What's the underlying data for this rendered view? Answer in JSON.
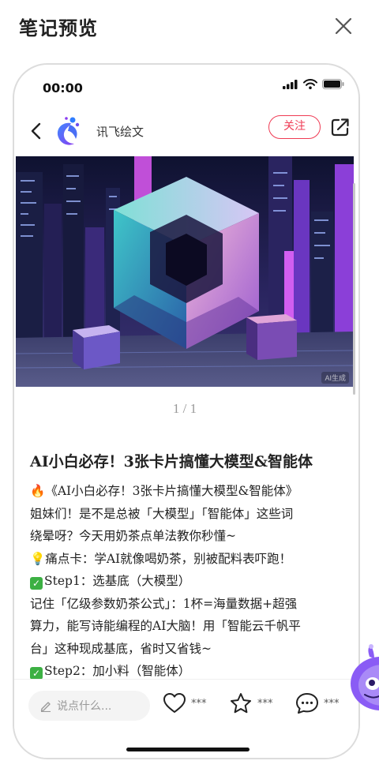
{
  "header": {
    "title": "笔记预览"
  },
  "status_bar": {
    "time": "00:00"
  },
  "author": {
    "name": "讯飞绘文",
    "follow_label": "关注"
  },
  "image": {
    "ai_tag": "AI生成"
  },
  "pager": {
    "text": "1 / 1"
  },
  "note": {
    "title": "AI小白必存！3张卡片搞懂大模型&智能体",
    "lines": [
      "《AI小白必存！3张卡片搞懂大模型&智能体》",
      "姐妹们！是不是总被「大模型」「智能体」这些词",
      "绕晕呀？今天用奶茶点单法教你秒懂~",
      "痛点卡：学AI就像喝奶茶，别被配料表吓跑！",
      "Step1：选基底（大模型）",
      "记住「亿级参数奶茶公式」：1杯=海量数据+超强",
      "算力，能写诗能编程的AI大脑！用「智能云千帆平",
      "台」这种现成基底，省时又省钱~",
      "Step2：加小料（智能体）"
    ]
  },
  "footer": {
    "comment_placeholder": "说点什么...",
    "like_count": "***",
    "collect_count": "***",
    "comment_count": "***"
  },
  "colors": {
    "accent": "#ef3b54",
    "check": "#3cb043"
  }
}
